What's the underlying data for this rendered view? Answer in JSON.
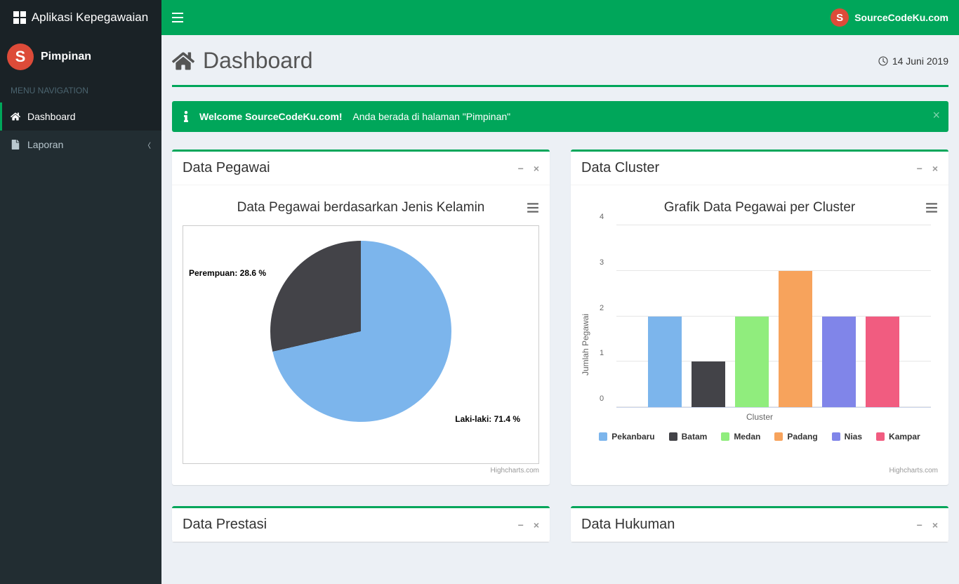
{
  "app_title": "Aplikasi Kepegawaian",
  "brand_text": "SourceCodeKu.com",
  "brand_letter": "S",
  "user": {
    "role": "Pimpinan",
    "letter": "S"
  },
  "menu_header": "MENU NAVIGATION",
  "menu": [
    {
      "label": "Dashboard",
      "icon": "home",
      "active": true,
      "has_children": false
    },
    {
      "label": "Laporan",
      "icon": "file",
      "active": false,
      "has_children": true
    }
  ],
  "page": {
    "title": "Dashboard",
    "date": "14 Juni 2019"
  },
  "alert": {
    "welcome_strong": "Welcome SourceCodeKu.com!",
    "message": "Anda berada di halaman \"Pimpinan\""
  },
  "boxes": {
    "pegawai": {
      "title": "Data Pegawai"
    },
    "cluster": {
      "title": "Data Cluster"
    },
    "prestasi": {
      "title": "Data Prestasi"
    },
    "hukuman": {
      "title": "Data Hukuman"
    }
  },
  "credits_label": "Highcharts.com",
  "chart_data": [
    {
      "id": "pie_gender",
      "type": "pie",
      "title": "Data Pegawai berdasarkan Jenis Kelamin",
      "series": [
        {
          "name": "Laki-laki",
          "value": 71.4,
          "color": "#7cb5ec",
          "label": "Laki-laki: 71.4 %"
        },
        {
          "name": "Perempuan",
          "value": 28.6,
          "color": "#434348",
          "label": "Perempuan: 28.6 %"
        }
      ]
    },
    {
      "id": "bar_cluster",
      "type": "bar",
      "title": "Grafik Data Pegawai per Cluster",
      "xlabel": "Cluster",
      "ylabel": "Jumlah Pegawai",
      "ylim": [
        0,
        4
      ],
      "yticks": [
        0,
        1,
        2,
        3,
        4
      ],
      "categories": [
        "Pekanbaru",
        "Batam",
        "Medan",
        "Padang",
        "Nias",
        "Kampar"
      ],
      "series": [
        {
          "name": "Pekanbaru",
          "value": 2,
          "color": "#7cb5ec"
        },
        {
          "name": "Batam",
          "value": 1,
          "color": "#434348"
        },
        {
          "name": "Medan",
          "value": 2,
          "color": "#90ed7d"
        },
        {
          "name": "Padang",
          "value": 3,
          "color": "#f7a35c"
        },
        {
          "name": "Nias",
          "value": 2,
          "color": "#8085e9"
        },
        {
          "name": "Kampar",
          "value": 2,
          "color": "#f15c80"
        }
      ]
    }
  ]
}
